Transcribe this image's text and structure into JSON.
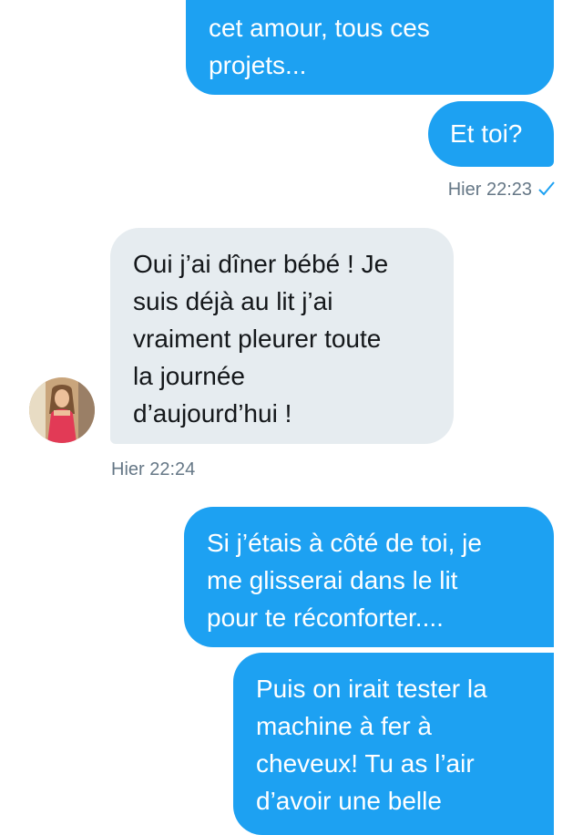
{
  "conversation": {
    "messages": [
      {
        "direction": "outgoing",
        "text": "cet amour, tous ces\nprojets..."
      },
      {
        "direction": "outgoing",
        "text": "Et toi?"
      },
      {
        "direction": "incoming",
        "text": "Oui j’ai dîner bébé ! Je\nsuis déjà au lit j’ai\nvraiment pleurer toute\nla journée\nd’aujourd’hui !"
      },
      {
        "direction": "outgoing",
        "text": "Si j’étais à côté de toi, je\nme glisserai dans le lit\npour te réconforter...."
      },
      {
        "direction": "outgoing",
        "text": "Puis on irait tester la\nmachine à fer à\ncheveux! Tu as l’air\nd’avoir une belle"
      }
    ],
    "timestamps": {
      "sent": "Hier 22:23",
      "received": "Hier 22:24"
    },
    "read_receipt_icon": "checkmark-icon",
    "contact_avatar_icon": "contact-avatar-photo"
  },
  "colors": {
    "outgoing_bubble": "#1da1f2",
    "incoming_bubble": "#e6ecf0",
    "timestamp_text": "#657786"
  }
}
